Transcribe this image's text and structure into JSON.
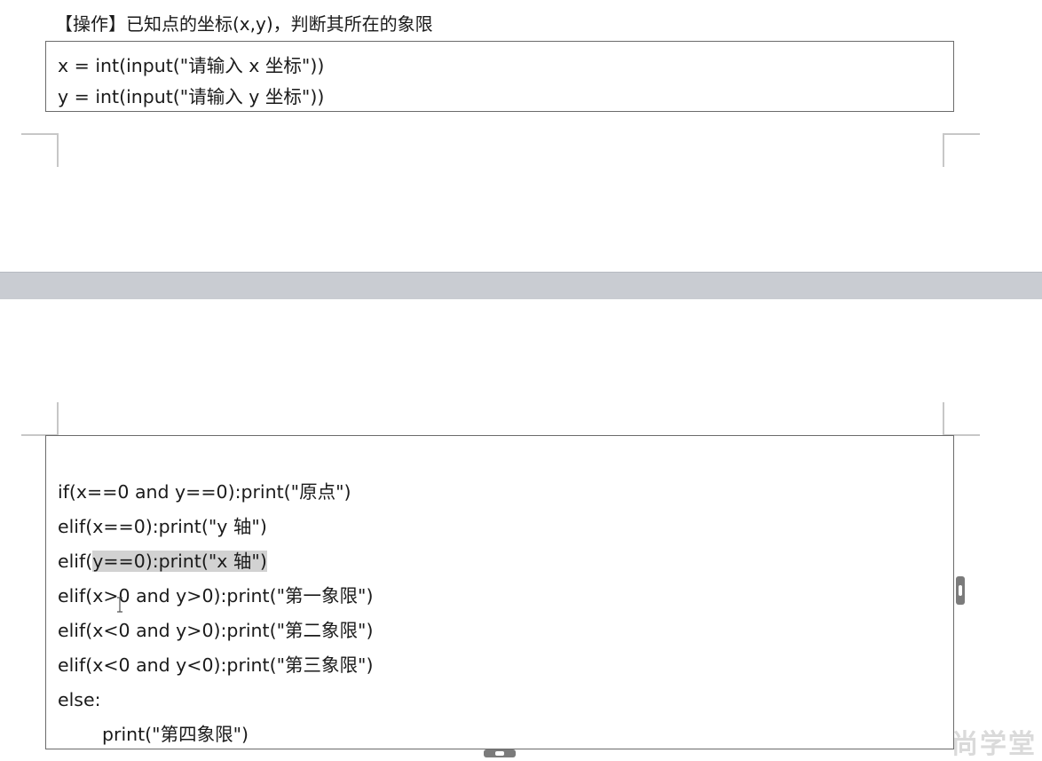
{
  "heading": "【操作】已知点的坐标(x,y)，判断其所在的象限",
  "top_code": [
    "x = int(input(\"请输入 x 坐标\"))",
    "y = int(input(\"请输入 y 坐标\"))"
  ],
  "bottom_code": {
    "line1": "if(x==0 and y==0):print(\"原点\")",
    "line2": "elif(x==0):print(\"y 轴\")",
    "line3_pre": "elif(",
    "line3_hl": "y==0):print(\"x 轴\")",
    "line4": "elif(x>0 and y>0):print(\"第一象限\")",
    "line5": "elif(x<0 and y>0):print(\"第二象限\")",
    "line6": "elif(x<0 and y<0):print(\"第三象限\")",
    "line7": "else:",
    "line8": "print(\"第四象限\")"
  },
  "watermark": "尚学堂",
  "colors": {
    "page_gap": "#c9ccd2",
    "highlight": "#d2d2d2",
    "box_border": "#6b6b6b"
  }
}
